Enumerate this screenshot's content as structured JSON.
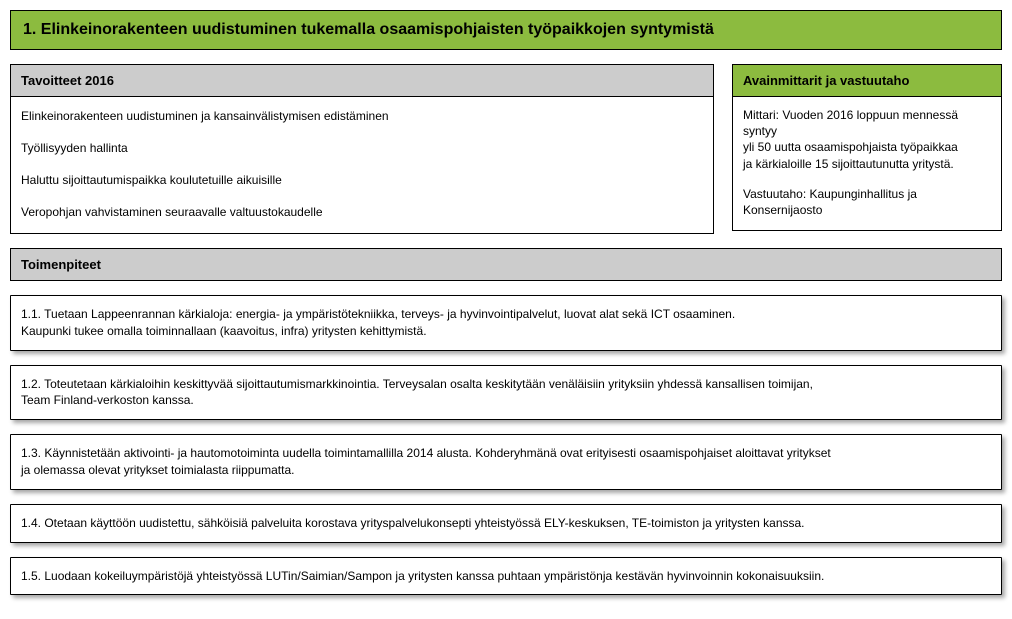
{
  "title": "1. Elinkeinorakenteen uudistuminen tukemalla osaamispohjaisten työpaikkojen syntymistä",
  "goals_header": "Tavoitteet 2016",
  "goals": [
    "Elinkeinorakenteen uudistuminen ja kansainvälistymisen edistäminen",
    "Työllisyyden hallinta",
    "Haluttu sijoittautumispaikka koulutetuille aikuisille",
    "Veropohjan vahvistaminen seuraavalle valtuustokaudelle"
  ],
  "indicators_header": "Avainmittarit ja vastuutaho",
  "indicators": {
    "mittari_l1": "Mittari: Vuoden 2016 loppuun mennessä syntyy",
    "mittari_l2": "yli 50 uutta osaamispohjaista työpaikkaa",
    "mittari_l3": " ja kärkialoille 15 sijoittautunutta yritystä.",
    "vastuu_l1": "Vastuutaho: Kaupunginhallitus ja",
    "vastuu_l2": "Konsernijaosto"
  },
  "actions_header": "Toimenpiteet",
  "actions": [
    {
      "l1": "1.1. Tuetaan Lappeenrannan kärkialoja: energia- ja ympäristötekniikka, terveys- ja hyvinvointipalvelut, luovat alat sekä ICT osaaminen.",
      "l2": "Kaupunki tukee omalla toiminnallaan (kaavoitus, infra)  yritysten kehittymistä."
    },
    {
      "l1": "1.2. Toteutetaan kärkialoihin keskittyvää sijoittautumismarkkinointia. Terveysalan osalta keskitytään venäläisiin yrityksiin yhdessä kansallisen toimijan,",
      "l2": "Team Finland-verkoston kanssa."
    },
    {
      "l1": "1.3. Käynnistetään aktivointi- ja hautomotoiminta uudella toimintamallilla 2014 alusta. Kohderyhmänä ovat erityisesti osaamispohjaiset aloittavat yritykset",
      "l2": "ja olemassa olevat yritykset toimialasta riippumatta."
    },
    {
      "l1": "1.4. Otetaan käyttöön uudistettu, sähköisiä palveluita korostava yrityspalvelukonsepti yhteistyössä  ELY-keskuksen,  TE-toimiston ja yritysten kanssa.",
      "l2": ""
    },
    {
      "l1": "1.5. Luodaan kokeiluympäristöjä yhteistyössä LUTin/Saimian/Sampon ja yritysten kanssa  puhtaan ympäristönja kestävän hyvinvoinnin  kokonaisuuksiin.",
      "l2": ""
    }
  ]
}
